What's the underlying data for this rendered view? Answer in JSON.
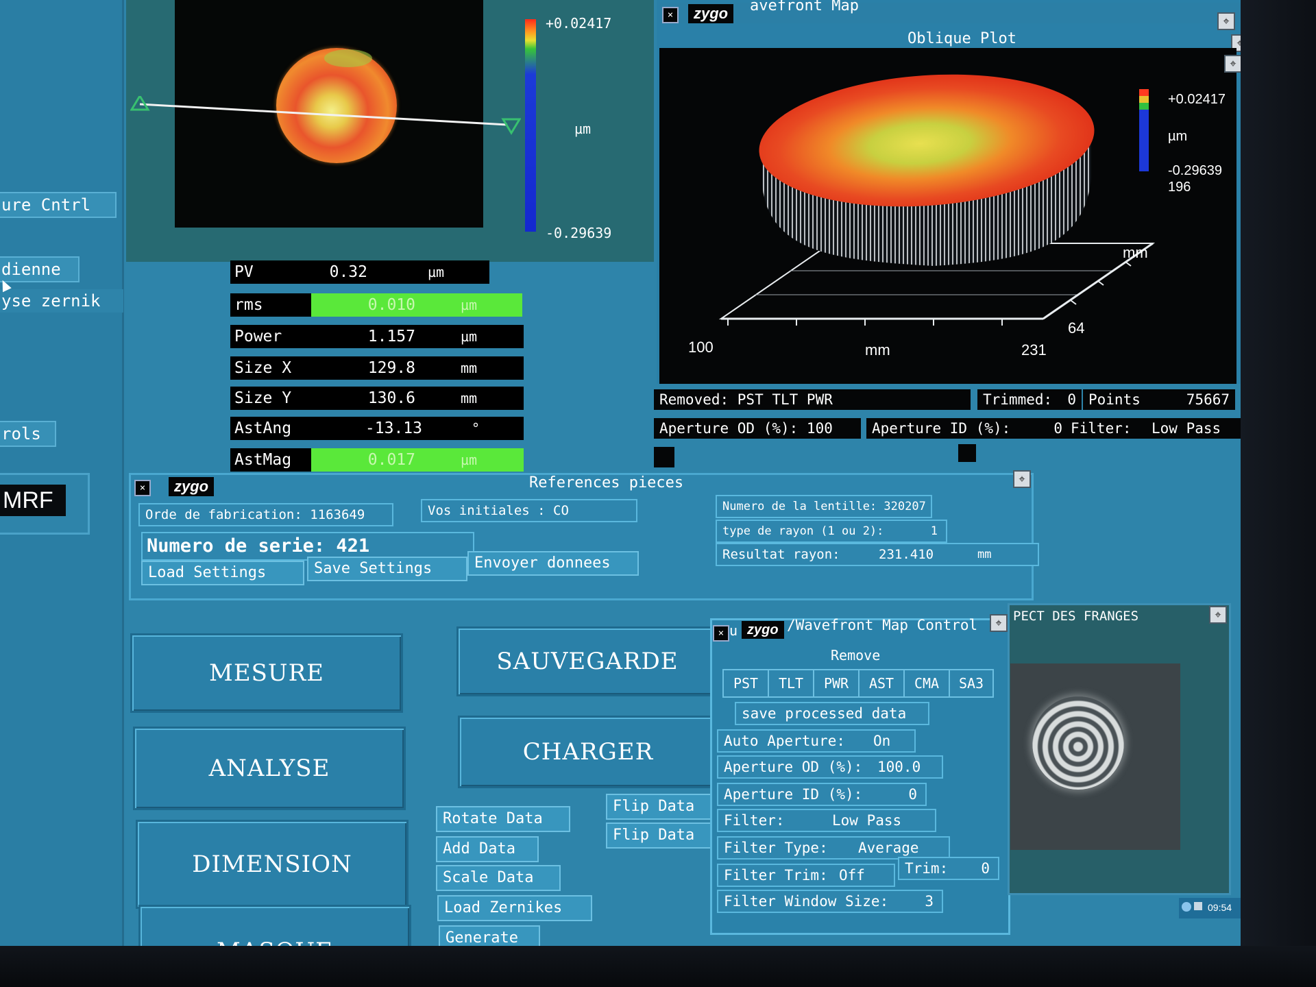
{
  "left": {
    "items": [
      "ure Cntrl",
      "dienne",
      "yse zernik",
      "rols"
    ],
    "mrf_label": "MRF"
  },
  "map": {
    "colorbar_max": "+0.02417",
    "colorbar_unit": "µm",
    "colorbar_min": "-0.29639"
  },
  "measurements": [
    {
      "label": "PV",
      "value": "0.32",
      "unit": "µm",
      "highlight": false
    },
    {
      "label": "rms",
      "value": "0.010",
      "unit": "µm",
      "highlight": true
    },
    {
      "label": "Power",
      "value": "1.157",
      "unit": "µm",
      "highlight": false
    },
    {
      "label": "Size X",
      "value": "129.8",
      "unit": "mm",
      "highlight": false
    },
    {
      "label": "Size Y",
      "value": "130.6",
      "unit": "mm",
      "highlight": false
    },
    {
      "label": "AstAng",
      "value": "-13.13",
      "unit": "°",
      "highlight": false
    },
    {
      "label": "AstMag",
      "value": "0.017",
      "unit": "µm",
      "highlight": true
    }
  ],
  "wavefront": {
    "window_title": "avefront Map",
    "logo": "zygo",
    "plot_title": "Oblique Plot",
    "colorbar_max": "+0.02417",
    "colorbar_unit": "µm",
    "colorbar_min": "-0.29639",
    "colorbar_extra": "196",
    "axis_x_start": "100",
    "axis_x_label": "mm",
    "axis_x_end": "231",
    "axis_y_end": "64",
    "axis_y_label": "mm",
    "removed": "Removed: PST TLT PWR",
    "trimmed_label": "Trimmed:",
    "trimmed_value": "0",
    "points_label": "Points",
    "points_value": "75667",
    "aperture_od": "Aperture OD (%): 100",
    "aperture_id_label": "Aperture ID (%):",
    "aperture_id_value": "0",
    "filter_label": "Filter:",
    "filter_value": "Low Pass"
  },
  "references": {
    "logo": "zygo",
    "title": "References pieces",
    "ordre": "Orde de fabrication: 1163649",
    "initiales": "Vos initiales : CO",
    "serie": "Numero de serie: 421",
    "load": "Load Settings",
    "save": "Save Settings",
    "envoyer": "Envoyer donnees",
    "lentille": "Numero de la lentille: 320207",
    "type_rayon_label": "type de rayon (1 ou 2):",
    "type_rayon_value": "1",
    "resultat_label": "Resultat rayon:",
    "resultat_value": "231.410",
    "resultat_unit": "mm"
  },
  "nav": {
    "mesure": "MESURE",
    "analyse": "ANALYSE",
    "dimension": "DIMENSION",
    "masque": "MASQUE",
    "sauvegarde": "SAUVEGARDE",
    "charger": "CHARGER",
    "rotate": "Rotate Data",
    "add": "Add Data",
    "scale": "Scale Data",
    "load_zernikes": "Load Zernikes",
    "generate": "Generate",
    "flip1": "Flip Data",
    "flip2": "Flip Data"
  },
  "control": {
    "title_prefix": "u",
    "logo": "zygo",
    "title": "/Wavefront Map Control",
    "remove_label": "Remove",
    "tabs": [
      "PST",
      "TLT",
      "PWR",
      "AST",
      "CMA",
      "SA3"
    ],
    "save_processed": "save processed data",
    "auto_aperture_label": "Auto Aperture:",
    "auto_aperture_value": "On",
    "aperture_od_label": "Aperture OD (%):",
    "aperture_od_value": "100.0",
    "aperture_id_label": "Aperture ID (%):",
    "aperture_id_value": "0",
    "filter_label": "Filter:",
    "filter_value": "Low Pass",
    "filter_type_label": "Filter Type:",
    "filter_type_value": "Average",
    "filter_trim_label": "Filter Trim:",
    "filter_trim_value": "Off",
    "trim_label": "Trim:",
    "trim_value": "0",
    "filter_window_label": "Filter Window Size:",
    "filter_window_value": "3"
  },
  "fringes": {
    "title": "PECT DES FRANGES"
  },
  "taskbar": {
    "time": "09:54"
  }
}
